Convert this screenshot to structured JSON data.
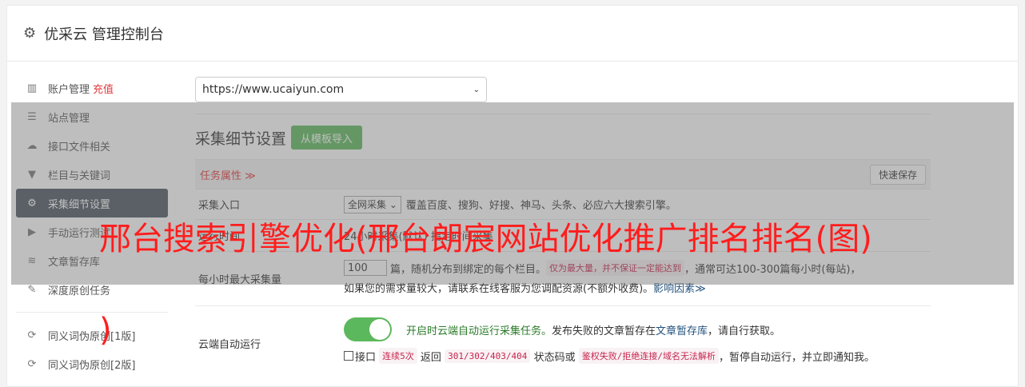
{
  "header": {
    "title": "优采云 管理控制台"
  },
  "sidebar": {
    "items": [
      {
        "label": "账户管理",
        "extra": "充值"
      },
      {
        "label": "站点管理"
      },
      {
        "label": "接口文件相关"
      },
      {
        "label": "栏目与关键词"
      },
      {
        "label": "采集细节设置"
      },
      {
        "label": "手动运行测试"
      },
      {
        "label": "文章暂存库"
      },
      {
        "label": "深度原创任务"
      },
      {
        "label": "同义词伪原创[1版]"
      },
      {
        "label": "同义词伪原创[2版]"
      }
    ]
  },
  "main": {
    "url_select": "https://www.ucaiyun.com",
    "section_title": "采集细节设置",
    "import_button": "从模板导入",
    "task_attr": "任务属性 ≫",
    "quick_save": "快速保存",
    "row1": {
      "label": "采集入口",
      "select": "全网采集",
      "text": "覆盖百度、搜狗、好搜、神马、头条、必应六大搜索引擎。"
    },
    "row2": {
      "label": "运行时间",
      "text": "24小时采集(默认)  指定时间采集"
    },
    "row3": {
      "label": "每小时最大采集量",
      "value": "100",
      "text1": "篇，随机分布到绑定的每个栏目。",
      "code1": "仅为最大量，并不保证一定能达到",
      "text2": "，通常可达100-300篇每小时(每站)，",
      "text3": "如果您的需求量较大，请联系在线客服为您调配资源(不额外收费)。",
      "link": "影响因素≫"
    },
    "row4": {
      "label": "云端自动运行",
      "text1": "开启时云端自动运行采集任务。",
      "text2": "发布失败的文章暂存在",
      "link": "文章暂存库",
      "text3": "，请自行获取。",
      "chk_label": "接口",
      "code1": "连续5次",
      "text4": "返回",
      "code2": "301/302/403/404",
      "text5": "状态码或",
      "code3": "鉴权失败/拒绝连接/域名无法解析",
      "text6": "，暂停自动运行，并立即通知我。"
    }
  },
  "watermark": {
    "line1": "邢台搜索引擎优化(邢台朗宸网站优化推广排名排名(图)",
    "line2": ")"
  }
}
